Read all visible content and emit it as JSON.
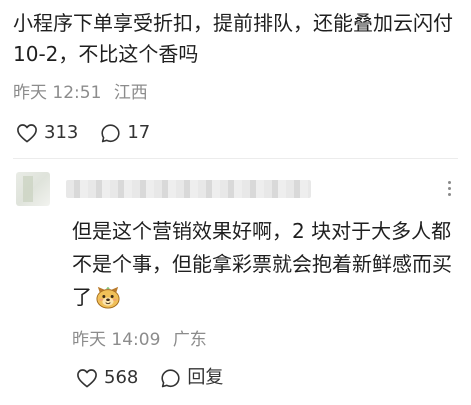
{
  "main_comment": {
    "text": "小程序下单享受折扣，提前排队，还能叠加云闪付10-2，不比这个香吗",
    "time": "昨天 12:51",
    "location": "江西",
    "likes": "313",
    "comments": "17"
  },
  "reply": {
    "text": "但是这个营销效果好啊，2 块对于大多人都不是个事，但能拿彩票就会抱着新鲜感而买了",
    "emoji": "dog-face-emoji",
    "time": "昨天 14:09",
    "location": "广东",
    "likes": "568",
    "reply_label": "回复"
  },
  "icons": {
    "like": "heart-outline-icon",
    "comment": "speech-bubble-icon",
    "more": "more-vertical-icon"
  },
  "colors": {
    "text": "#1f1f1f",
    "meta": "#8c8c8c",
    "icon": "#333333"
  }
}
